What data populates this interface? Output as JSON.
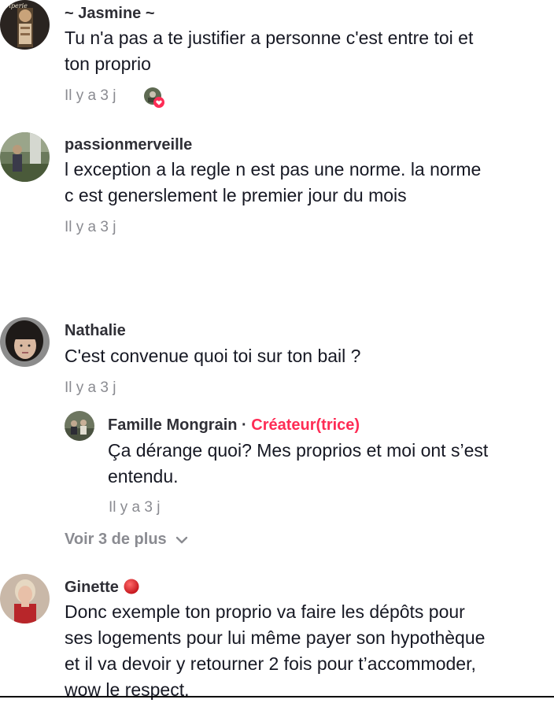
{
  "comments": [
    {
      "username": "~ Jasmine ~",
      "avatar_label": "Friperie",
      "text_lines": [
        "Tu n'a pas a te justifier a personne c'est entre toi et",
        "ton proprio"
      ],
      "time": "Il y a 3 j",
      "liked_by_creator": true
    },
    {
      "username": "passionmerveille",
      "text_lines": [
        "l exception a la regle n est pas une norme. la norme",
        "c est generslement le premier jour du mois"
      ],
      "time": "Il y a 3 j"
    },
    {
      "username": "Nathalie",
      "text_lines": [
        "C'est convenue quoi toi sur ton bail ?"
      ],
      "time": "Il y a 3 j",
      "reply": {
        "username": "Famille Mongrain",
        "separator": "·",
        "badge": "Créateur(trice)",
        "text_lines": [
          "Ça dérange quoi? Mes proprios et moi ont s’est",
          "entendu."
        ],
        "time": "Il y a 3 j"
      },
      "view_more": "Voir 3 de plus"
    },
    {
      "username": "Ginette",
      "text_lines": [
        "Donc exemple ton proprio va faire les dépôts pour",
        "ses logements pour lui même payer son hypothèque",
        "et il va devoir y retourner 2 fois pour t’accommoder,",
        "wow le respect."
      ]
    }
  ],
  "colors": {
    "creator_accent": "#fe2c55",
    "muted_text": "#8a8b91",
    "username": "#2f2f36",
    "body_text": "#161823"
  },
  "icons": {
    "view_more": "chevron-down-icon",
    "liked": "heart-icon",
    "status_dot": "red-circle-icon"
  }
}
